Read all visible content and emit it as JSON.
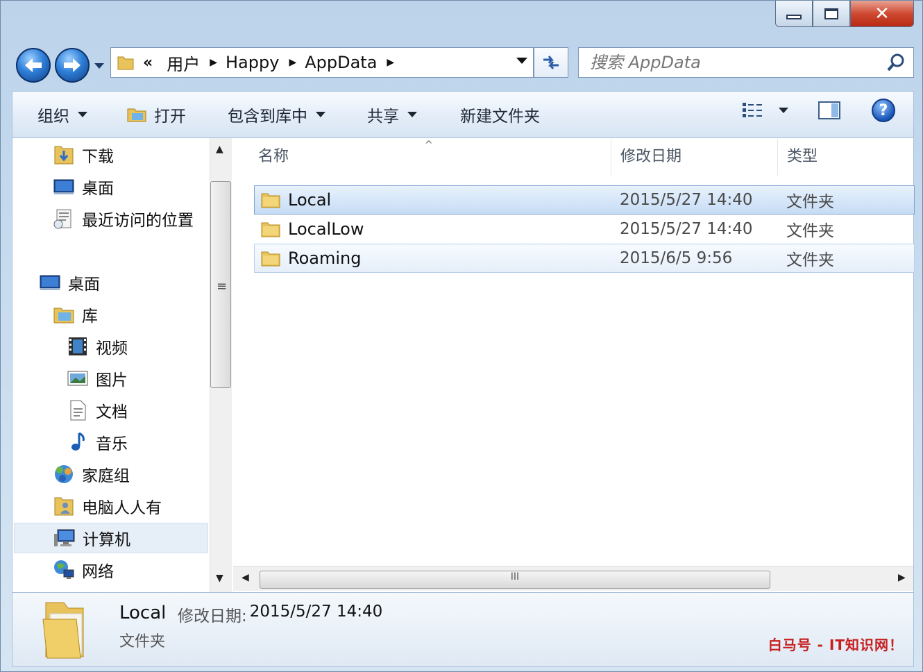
{
  "window": {
    "caption": {
      "minimize": "minimize",
      "maximize": "maximize",
      "close": "✕"
    }
  },
  "nav": {
    "breadcrumb": [
      {
        "label": "用户"
      },
      {
        "label": "Happy"
      },
      {
        "label": "AppData"
      }
    ],
    "overflow": "«",
    "search_placeholder": "搜索 AppData"
  },
  "toolbar": {
    "organize": "组织",
    "open": "打开",
    "include_library": "包含到库中",
    "share": "共享",
    "new_folder": "新建文件夹"
  },
  "navpane": {
    "favorites": [
      {
        "label": "下载",
        "icon": "downloads-folder-icon"
      },
      {
        "label": "桌面",
        "icon": "desktop-icon"
      },
      {
        "label": "最近访问的位置",
        "icon": "recent-places-icon"
      }
    ],
    "tree": [
      {
        "label": "桌面",
        "icon": "desktop-icon"
      },
      {
        "label": "库",
        "icon": "library-icon"
      },
      {
        "label": "视频",
        "icon": "video-icon"
      },
      {
        "label": "图片",
        "icon": "pictures-icon"
      },
      {
        "label": "文档",
        "icon": "documents-icon"
      },
      {
        "label": "音乐",
        "icon": "music-icon"
      },
      {
        "label": "家庭组",
        "icon": "homegroup-icon"
      },
      {
        "label": "电脑人人有",
        "icon": "user-folder-icon"
      },
      {
        "label": "计算机",
        "icon": "computer-icon"
      },
      {
        "label": "网络",
        "icon": "network-icon"
      }
    ]
  },
  "files": {
    "columns": {
      "name": "名称",
      "date": "修改日期",
      "type": "类型"
    },
    "rows": [
      {
        "name": "Local",
        "date": "2015/5/27 14:40",
        "type": "文件夹",
        "state": "selected"
      },
      {
        "name": "LocalLow",
        "date": "2015/5/27 14:40",
        "type": "文件夹",
        "state": "normal"
      },
      {
        "name": "Roaming",
        "date": "2015/6/5 9:56",
        "type": "文件夹",
        "state": "hover"
      }
    ]
  },
  "details": {
    "name": "Local",
    "date_label": "修改日期:",
    "date": "2015/5/27 14:40",
    "type": "文件夹"
  },
  "watermark": "白马号 - IT知识网！",
  "colors": {
    "selection": "#c6dcf5",
    "watermark": "#c81e1e",
    "folder": "#e8c25a"
  }
}
